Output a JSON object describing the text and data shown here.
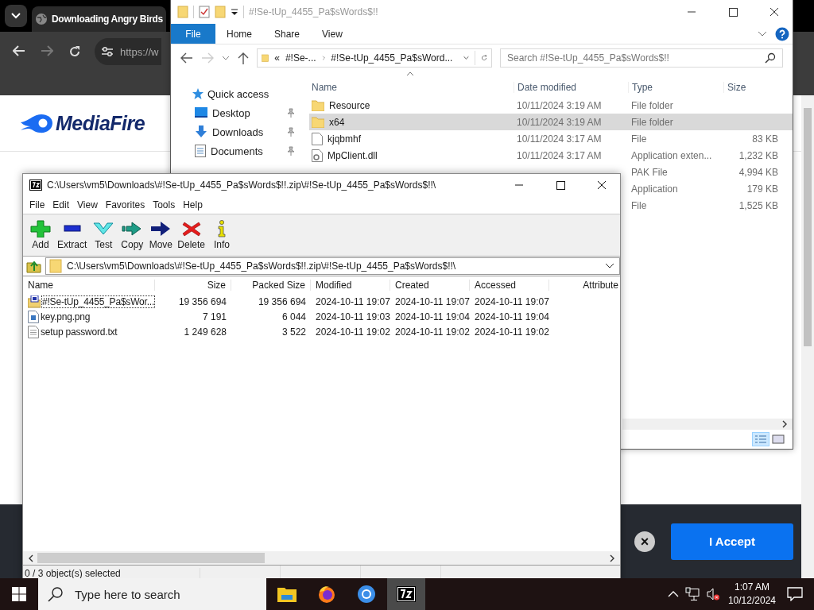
{
  "browser": {
    "tab_title": "Downloading Angry Birds",
    "url": "https://w",
    "logo_text": "MediaFire",
    "banner": {
      "close": "×",
      "accept": "I Accept"
    }
  },
  "explorer": {
    "title": "#!Se-tUp_4455_Pa$sWords$!!",
    "ribbon_tabs": [
      {
        "label": "File",
        "selected": true
      },
      {
        "label": "Home",
        "selected": false
      },
      {
        "label": "Share",
        "selected": false
      },
      {
        "label": "View",
        "selected": false
      }
    ],
    "breadcrumb": [
      "«",
      "#!Se-...",
      "#!Se-tUp_4455_Pa$sWord..."
    ],
    "search_placeholder": "Search #!Se-tUp_4455_Pa$sWords$!!",
    "nav": [
      {
        "label": "Quick access",
        "kind": "quick"
      },
      {
        "label": "Desktop",
        "kind": "desktop",
        "pinned": true
      },
      {
        "label": "Downloads",
        "kind": "downloads",
        "pinned": true
      },
      {
        "label": "Documents",
        "kind": "documents",
        "pinned": true
      }
    ],
    "columns": [
      "Name",
      "Date modified",
      "Type",
      "Size"
    ],
    "rows": [
      {
        "kind": "folder",
        "name": "Resource",
        "date": "10/11/2024 3:19 AM",
        "type": "File folder",
        "selected": false
      },
      {
        "kind": "folder",
        "name": "x64",
        "date": "10/11/2024 3:19 AM",
        "type": "File folder",
        "selected": true
      },
      {
        "kind": "file",
        "name": "kjqbmhf",
        "date": "10/11/2024 3:17 AM",
        "type": "File",
        "size": "83 KB",
        "selected": false
      },
      {
        "kind": "dll",
        "name": "MpClient.dll",
        "date": "10/11/2024 3:17 AM",
        "type": "Application exten...",
        "size": "1,232 KB",
        "selected": false
      },
      {
        "type": "PAK File",
        "size": "4,994 KB",
        "selected": false
      },
      {
        "type": "Application",
        "size": "179 KB",
        "selected": false
      },
      {
        "type": "File",
        "size": "1,525 KB",
        "selected": false
      }
    ]
  },
  "sevenzip": {
    "title": "C:\\Users\\vm5\\Downloads\\#!Se-tUp_4455_Pa$sWords$!!.zip\\#!Se-tUp_4455_Pa$sWords$!!\\",
    "menu": [
      "File",
      "Edit",
      "View",
      "Favorites",
      "Tools",
      "Help"
    ],
    "tools": [
      {
        "kind": "add",
        "label": "Add"
      },
      {
        "kind": "extract",
        "label": "Extract"
      },
      {
        "kind": "test",
        "label": "Test"
      },
      {
        "kind": "copy",
        "label": "Copy"
      },
      {
        "kind": "move",
        "label": "Move"
      },
      {
        "kind": "delete",
        "label": "Delete"
      },
      {
        "kind": "info",
        "label": "Info"
      }
    ],
    "path": "C:\\Users\\vm5\\Downloads\\#!Se-tUp_4455_Pa$sWords$!!.zip\\#!Se-tUp_4455_Pa$sWords$!!\\",
    "columns": [
      "Name",
      "Size",
      "Packed Size",
      "Modified",
      "Created",
      "Accessed",
      "Attribute"
    ],
    "rows": [
      {
        "kind": "archive",
        "name": "#!Se-tUp_4455_Pa$sWor...",
        "size": "19 356 694",
        "packed": "19 356 694",
        "modified": "2024-10-11 19:07",
        "created": "2024-10-11 19:07",
        "accessed": "2024-10-11 19:07",
        "focused": true
      },
      {
        "kind": "image",
        "name": "key.png.png",
        "size": "7 191",
        "packed": "6 044",
        "modified": "2024-10-11 19:03",
        "created": "2024-10-11 19:04",
        "accessed": "2024-10-11 19:04",
        "focused": false
      },
      {
        "kind": "text",
        "name": "setup password.txt",
        "size": "1 249 628",
        "packed": "3 522",
        "modified": "2024-10-11 19:02",
        "created": "2024-10-11 19:02",
        "accessed": "2024-10-11 19:02",
        "focused": false
      }
    ],
    "status": "0 / 3 object(s) selected"
  },
  "taskbar": {
    "search_placeholder": "Type here to search",
    "apps": [
      {
        "kind": "explorer",
        "selected": false
      },
      {
        "kind": "firefox",
        "selected": false
      },
      {
        "kind": "chrome",
        "selected": false
      },
      {
        "kind": "sevenzip",
        "selected": true
      }
    ],
    "time": "1:07 AM",
    "date": "10/12/2024"
  }
}
